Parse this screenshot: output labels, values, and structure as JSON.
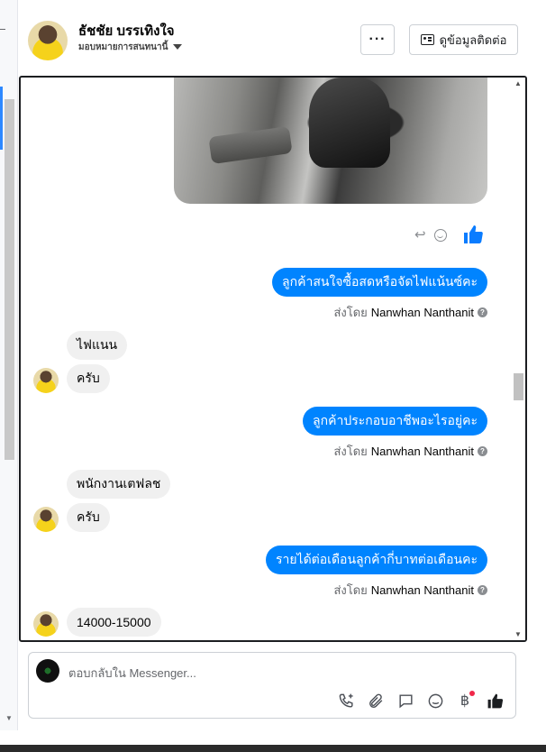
{
  "header": {
    "name": "ธัชชัย บรรเทิงใจ",
    "subtitle": "มอบหมายการสนทนานี้",
    "more_label": "···",
    "contact_label": "ดูข้อมูลติดต่อ"
  },
  "messages": [
    {
      "type": "out",
      "text": "ลูกค้าสนใจซื้อสดหรือจัดไฟแน้นซ์คะ",
      "sent_by_prefix": "ส่งโดย",
      "sent_by": "Nanwhan Nanthanit"
    },
    {
      "type": "in",
      "text": "ไฟแนน"
    },
    {
      "type": "in",
      "text": "ครับ"
    },
    {
      "type": "out",
      "text": "ลูกค้าประกอบอาชีพอะไรอยู่คะ",
      "sent_by_prefix": "ส่งโดย",
      "sent_by": "Nanwhan Nanthanit"
    },
    {
      "type": "in",
      "text": "พนักงานเตฟลช"
    },
    {
      "type": "in",
      "text": "ครับ"
    },
    {
      "type": "out",
      "text": "รายได้ต่อเดือนลูกค้ากี่บาทต่อเดือนคะ",
      "sent_by_prefix": "ส่งโดย",
      "sent_by": "Nanwhan Nanthanit"
    },
    {
      "type": "in",
      "text": "14000-15000"
    }
  ],
  "composer": {
    "placeholder": "ตอบกลับใน Messenger..."
  },
  "icons": {
    "call": "phone-plus-icon",
    "attach": "paperclip-icon",
    "saved_reply": "chat-bubble-icon",
    "emoji": "smile-icon",
    "payment": "baht-icon",
    "like": "thumbs-up-icon",
    "baht_glyph": "฿"
  },
  "colors": {
    "accent": "#0084ff",
    "incoming_bubble": "#f0f0f0",
    "like": "#0a7cff"
  }
}
